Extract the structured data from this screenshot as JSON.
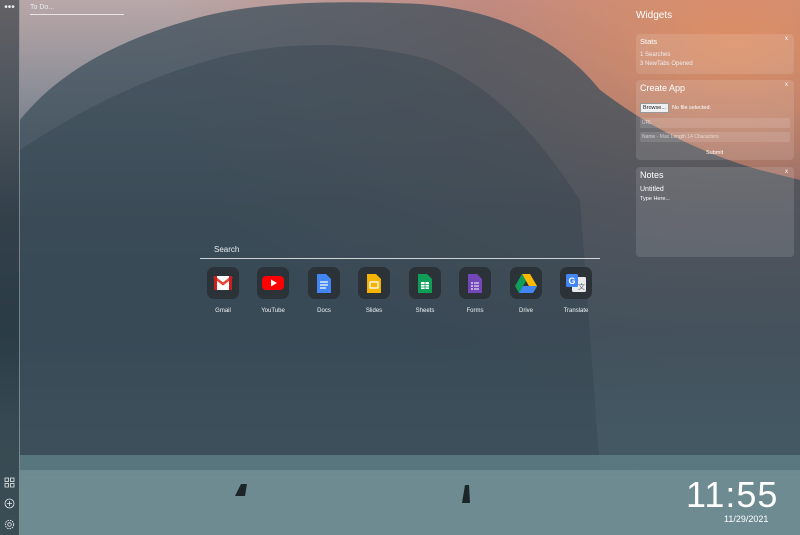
{
  "sidebar": {
    "menu_icon": "dots-icon",
    "bottom_icons": [
      "grid-icon",
      "add-icon",
      "settings-icon"
    ]
  },
  "todo": {
    "placeholder": "To Do..."
  },
  "widgets": {
    "title": "Widgets",
    "stats": {
      "title": "Stats",
      "line1": "1 Searches",
      "line2": "3 NewTabs Opened"
    },
    "create_app": {
      "title": "Create App",
      "browse_label": "Browse...",
      "file_status": "No file selected.",
      "url_placeholder": "URL",
      "name_placeholder": "Name - Max Length 14 Characters",
      "submit_label": "Submit"
    },
    "notes": {
      "title": "Notes",
      "note_title": "Untitled",
      "note_body": "Type Here..."
    },
    "close_label": "x"
  },
  "search": {
    "placeholder": "Search"
  },
  "apps": [
    {
      "name": "Gmail",
      "icon": "gmail-icon",
      "color": "#ea4335"
    },
    {
      "name": "YouTube",
      "icon": "youtube-icon",
      "color": "#ff0000"
    },
    {
      "name": "Docs",
      "icon": "docs-icon",
      "color": "#4285f4"
    },
    {
      "name": "Slides",
      "icon": "slides-icon",
      "color": "#f4b400"
    },
    {
      "name": "Sheets",
      "icon": "sheets-icon",
      "color": "#0f9d58"
    },
    {
      "name": "Forms",
      "icon": "forms-icon",
      "color": "#7248b9"
    },
    {
      "name": "Drive",
      "icon": "drive-icon",
      "color": "#34a853"
    },
    {
      "name": "Translate",
      "icon": "translate-icon",
      "color": "#4285f4"
    }
  ],
  "clock": {
    "time": "11:55",
    "date": "11/29/2021"
  }
}
